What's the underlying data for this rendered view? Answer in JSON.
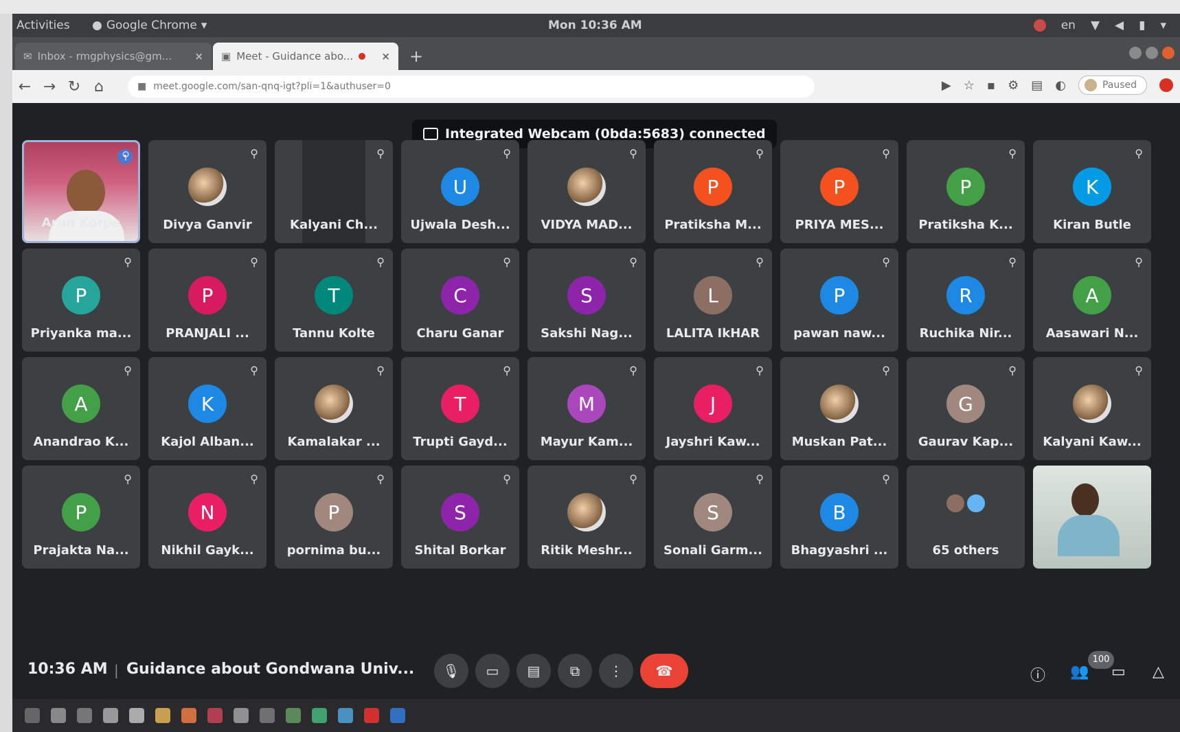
{
  "topbar": {
    "activities": "Activities",
    "app_menu": "Google Chrome",
    "clock": "Mon 10:36 AM",
    "lang": "en"
  },
  "tabs": [
    {
      "label": "Inbox - rmgphysics@gm...",
      "close": "×"
    },
    {
      "label": "Meet - Guidance abo...",
      "close": "×"
    }
  ],
  "new_tab": "+",
  "omnibox": {
    "url": "meet.google.com/san-qnq-igt?pli=1&authuser=0"
  },
  "profile": {
    "status": "Paused"
  },
  "toast": {
    "text": "Integrated Webcam (0bda:5683) connected"
  },
  "participants": [
    {
      "name": "Arun Korpe",
      "type": "video-self"
    },
    {
      "name": "Divya Ganvir",
      "type": "photo"
    },
    {
      "name": "Kalyani Ch...",
      "type": "split"
    },
    {
      "name": "Ujwala Desh...",
      "initial": "U",
      "color": "#1e88e5"
    },
    {
      "name": "VIDYA MAD...",
      "type": "photo"
    },
    {
      "name": "Pratiksha M...",
      "initial": "P",
      "color": "#f4511e"
    },
    {
      "name": "PRIYA MES...",
      "initial": "P",
      "color": "#f4511e"
    },
    {
      "name": "Pratiksha K...",
      "initial": "P",
      "color": "#43a047"
    },
    {
      "name": "Kiran Butle",
      "initial": "K",
      "color": "#039be5"
    },
    {
      "name": "Priyanka ma...",
      "initial": "P",
      "color": "#26a69a"
    },
    {
      "name": "PRANJALI ...",
      "initial": "P",
      "color": "#d81b60"
    },
    {
      "name": "Tannu Kolte",
      "initial": "T",
      "color": "#00897b"
    },
    {
      "name": "Charu Ganar",
      "initial": "C",
      "color": "#8e24aa"
    },
    {
      "name": "Sakshi Nag...",
      "initial": "S",
      "color": "#8e24aa"
    },
    {
      "name": "LALITA IkHAR",
      "initial": "L",
      "color": "#8d6e63"
    },
    {
      "name": "pawan naw...",
      "initial": "P",
      "color": "#1e88e5"
    },
    {
      "name": "Ruchika Nir...",
      "initial": "R",
      "color": "#1e88e5"
    },
    {
      "name": "Aasawari N...",
      "initial": "A",
      "color": "#43a047"
    },
    {
      "name": "Anandrao K...",
      "initial": "A",
      "color": "#43a047"
    },
    {
      "name": "Kajol Alban...",
      "initial": "K",
      "color": "#1e88e5"
    },
    {
      "name": "Kamalakar ...",
      "type": "photo"
    },
    {
      "name": "Trupti Gayd...",
      "initial": "T",
      "color": "#e91e63"
    },
    {
      "name": "Mayur Kam...",
      "initial": "M",
      "color": "#ab47bc"
    },
    {
      "name": "Jayshri Kaw...",
      "initial": "J",
      "color": "#e91e63"
    },
    {
      "name": "Muskan Pat...",
      "type": "photo"
    },
    {
      "name": "Gaurav Kap...",
      "initial": "G",
      "color": "#a1887f"
    },
    {
      "name": "Kalyani Kaw...",
      "type": "photo"
    },
    {
      "name": "Prajakta Na...",
      "initial": "P",
      "color": "#43a047"
    },
    {
      "name": "Nikhil Gayk...",
      "initial": "N",
      "color": "#e91e63"
    },
    {
      "name": "pornima bu...",
      "initial": "P",
      "color": "#a1887f"
    },
    {
      "name": "Shital Borkar",
      "initial": "S",
      "color": "#8e24aa"
    },
    {
      "name": "Ritik Meshr...",
      "type": "photo"
    },
    {
      "name": "Sonali Garm...",
      "initial": "S",
      "color": "#a1887f"
    },
    {
      "name": "Bhagyashri ...",
      "initial": "B",
      "color": "#1e88e5"
    },
    {
      "name": "65 others",
      "type": "others"
    },
    {
      "name": "",
      "type": "video-other"
    }
  ],
  "bottombar": {
    "time": "10:36 AM",
    "separator": "|",
    "title": "Guidance about Gondwana Univ...",
    "people_count": "100"
  },
  "icons": {
    "mic": "mic-icon",
    "camera": "camera-icon",
    "captions": "captions-icon",
    "present": "present-icon",
    "more": "more-vert-icon",
    "end": "end-call-icon",
    "info": "info-icon",
    "people": "people-icon",
    "chat": "chat-icon",
    "activities": "activities-icon"
  }
}
